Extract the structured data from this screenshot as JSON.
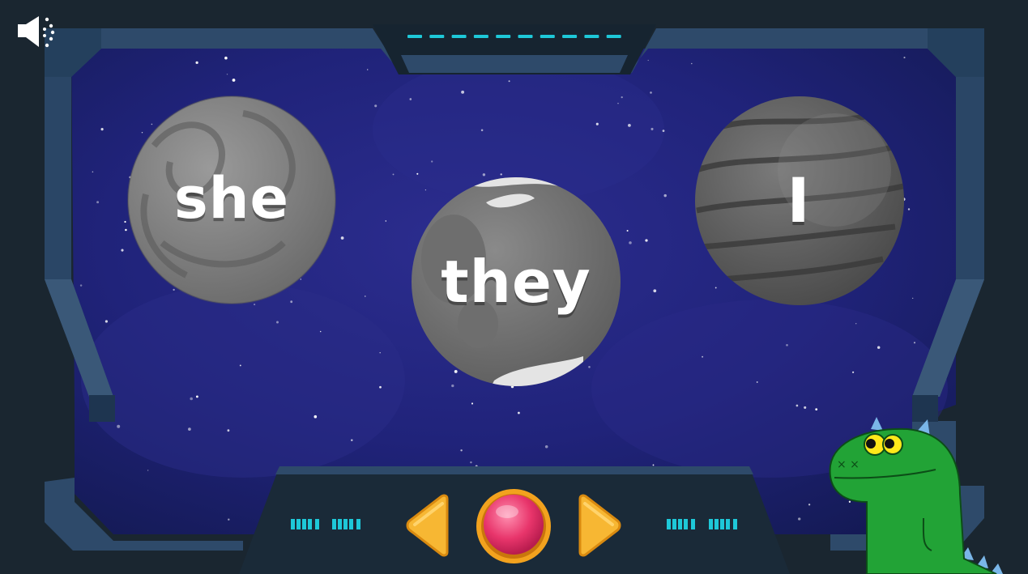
{
  "game": {
    "words": [
      "she",
      "they",
      "I"
    ],
    "progress_total": 10,
    "progress_completed": 0
  },
  "controls": {
    "sound": "speaker-icon",
    "prev": "left-arrow-icon",
    "record": "red-round-button",
    "next": "right-arrow-icon"
  },
  "colors": {
    "frame": "#2e4a6a",
    "frame_dark": "#1e3550",
    "console": "#162430",
    "indicator": "#1ec8d8",
    "arrow": "#f7b733",
    "record_button": "#e8356b",
    "dino": "#22a336"
  }
}
